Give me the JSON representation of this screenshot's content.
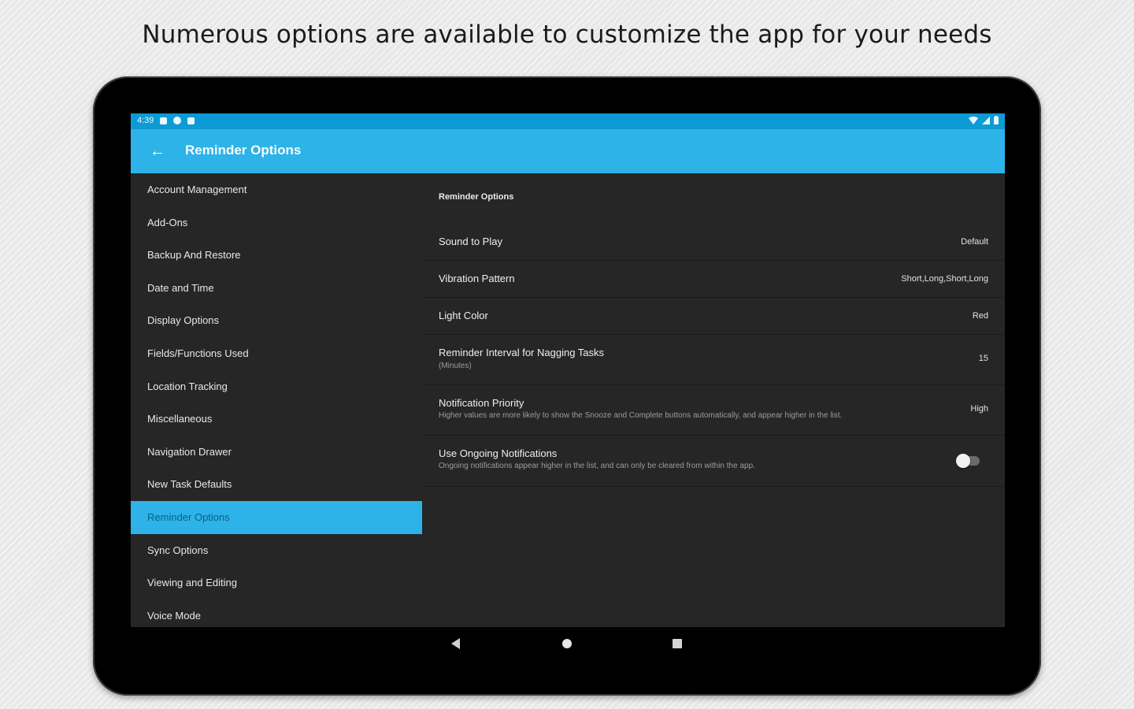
{
  "caption": "Numerous options are available to customize the app for your needs",
  "status_bar": {
    "time": "4:39",
    "icons_left": [
      "notification-icon",
      "sync-icon",
      "clipboard-icon"
    ],
    "icons_right": [
      "wifi-icon",
      "signal-icon",
      "battery-icon"
    ]
  },
  "app_bar": {
    "title": "Reminder Options",
    "back_icon": "arrow-left-icon",
    "back_glyph": "←"
  },
  "sidebar": {
    "items": [
      {
        "label": "Account Management"
      },
      {
        "label": "Add-Ons"
      },
      {
        "label": "Backup And Restore"
      },
      {
        "label": "Date and Time"
      },
      {
        "label": "Display Options"
      },
      {
        "label": "Fields/Functions Used"
      },
      {
        "label": "Location Tracking"
      },
      {
        "label": "Miscellaneous"
      },
      {
        "label": "Navigation Drawer"
      },
      {
        "label": "New Task Defaults"
      },
      {
        "label": "Reminder Options",
        "selected": true
      },
      {
        "label": "Sync Options"
      },
      {
        "label": "Viewing and Editing"
      },
      {
        "label": "Voice Mode"
      }
    ]
  },
  "content": {
    "section_title": "Reminder Options",
    "prefs": [
      {
        "title": "Sound to Play",
        "value": "Default"
      },
      {
        "title": "Vibration Pattern",
        "value": "Short,Long,Short,Long"
      },
      {
        "title": "Light Color",
        "value": "Red"
      },
      {
        "title": "Reminder Interval for Nagging Tasks",
        "subtitle": "(Minutes)",
        "value": "15"
      },
      {
        "title": "Notification Priority",
        "subtitle": "Higher values are more likely to show the Snooze and Complete buttons automatically, and appear higher in the list.",
        "value": "High"
      },
      {
        "title": "Use Ongoing Notifications",
        "subtitle": "Ongoing notifications appear higher in the list, and can only be cleared from within the app.",
        "toggle_on": false
      }
    ]
  },
  "nav_bar": {
    "buttons": [
      "back-triangle-icon",
      "home-circle-icon",
      "recents-square-icon"
    ]
  },
  "colors": {
    "accent": "#2db3e7",
    "status_bar": "#0d9bd5",
    "background": "#262626"
  }
}
